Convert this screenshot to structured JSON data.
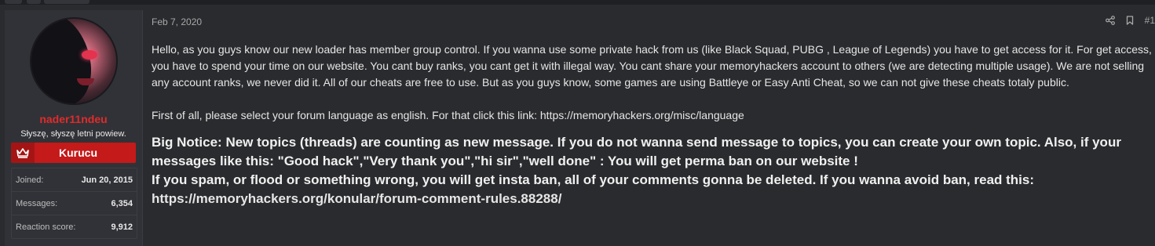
{
  "user": {
    "username": "nader11ndeu",
    "custom_title": "Słyszę, słyszę letni powiew.",
    "group_banner": "Kurucu",
    "stats": [
      {
        "label": "Joined:",
        "value": "Jun 20, 2015"
      },
      {
        "label": "Messages:",
        "value": "6,354"
      },
      {
        "label": "Reaction score:",
        "value": "9,912"
      }
    ]
  },
  "post": {
    "date": "Feb 7, 2020",
    "number": "#1",
    "paragraph1": "Hello, as you guys know our new loader has member group control. If you wanna use some private hack from us (like Black Squad, PUBG , League of Legends) you have to get access for it. For get access, you have to spend your time on our website. You cant buy ranks, you cant get it with illegal way. You cant share your memoryhackers account to others (we are detecting multiple usage). We are not selling any account ranks, we never did it. All of our cheats are free to use. But as you guys know, some games are using Battleye or Easy Anti Cheat, so we can not give these cheats totaly public.",
    "language_text": "First of all, please select your forum language as english. For that click this link: ",
    "language_link": "https://memoryhackers.org/misc/language",
    "notice1": "Big Notice: New topics (threads) are counting as new message. If you do not wanna send message to topics, you can create your own topic. Also, if your messages like this: \"Good hack\",\"Very thank you\",\"hi sir\",\"well done\" : You will get perma ban on our website !",
    "notice2": "If you spam, or flood or something wrong, you will get insta ban, all of your comments gonna be deleted. If you wanna avoid ban, read this:",
    "rules_link": "https://memoryhackers.org/konular/forum-comment-rules.88288/"
  },
  "colors": {
    "background": "#2a2b2e",
    "username": "#e02b2b",
    "banner": "#c41a1a"
  }
}
